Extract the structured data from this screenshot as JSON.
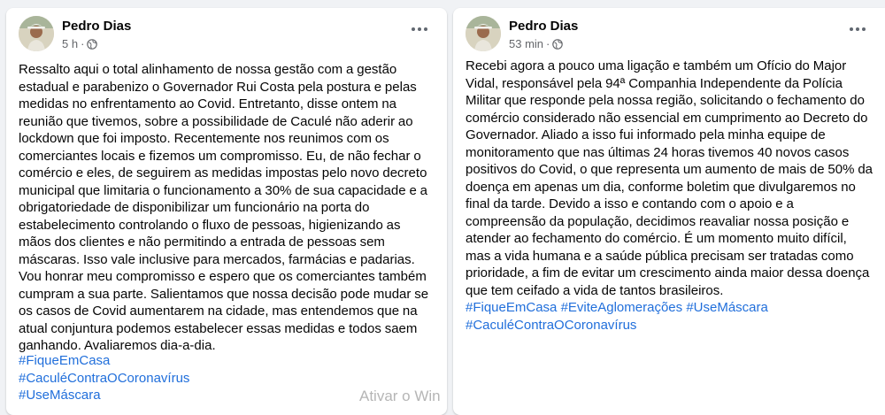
{
  "post_left": {
    "author": "Pedro Dias",
    "time": "5 h",
    "text": "Ressalto aqui o total alinhamento de nossa gestão com a gestão estadual e parabenizo o Governador Rui Costa pela postura e pelas medidas no enfrentamento ao Covid. Entretanto, disse ontem na reunião que tivemos, sobre a possibilidade de Caculé não aderir ao lockdown que foi imposto. Recentemente nos reunimos com os comerciantes locais e fizemos um compromisso. Eu, de não fechar o comércio e eles, de seguirem as medidas impostas pelo novo decreto municipal que limitaria o funcionamento a 30% de sua capacidade e a obrigatoriedade de disponibilizar um funcionário na porta do estabelecimento controlando o fluxo de pessoas, higienizando as mãos dos clientes e não permitindo a entrada de pessoas sem máscaras. Isso vale inclusive para mercados, farmácias e padarias. Vou honrar meu compromisso e espero que os comerciantes também cumpram a sua parte. Salientamos que nossa decisão pode mudar se os casos de Covid aumentarem na cidade, mas entendemos que na atual conjuntura podemos estabelecer essas medidas e todos saem ganhando. Avaliaremos dia-a-dia.",
    "hashtags": [
      "#FiqueEmCasa",
      "#CaculéContraOCoronavírus",
      "#UseMáscara"
    ]
  },
  "post_right": {
    "author": "Pedro Dias",
    "time": "53 min",
    "text": "Recebi agora a pouco uma ligação e também um Ofício do Major Vidal, responsável pela 94ª Companhia Independente da Polícia Militar que responde pela nossa região, solicitando o fechamento do comércio considerado não essencial em cumprimento ao Decreto do Governador. Aliado a isso fui informado pela minha equipe de monitoramento que nas últimas 24 horas tivemos 40 novos casos positivos do Covid, o que representa um aumento de mais de 50% da doença em apenas um dia, conforme boletim que divulgaremos no final da tarde. Devido a isso e contando com o apoio e a compreensão da população, decidimos reavaliar nossa posição e atender ao fechamento do comércio. É um momento muito difícil, mas a vida humana e a saúde pública precisam ser tratadas como prioridade, a fim de evitar um crescimento ainda maior dessa doença que tem ceifado a vida de tantos brasileiros.",
    "hashtags": [
      "#FiqueEmCasa",
      "#EviteAglomerações",
      "#UseMáscara",
      "#CaculéContraOCoronavírus"
    ]
  },
  "watermark": "Ativar o Win",
  "colors": {
    "background": "#f0f2f5",
    "card": "#ffffff",
    "hashtag": "#216fdb",
    "meta": "#65676b"
  },
  "icons": {
    "privacy": "globe-icon",
    "menu": "more-options-icon"
  }
}
